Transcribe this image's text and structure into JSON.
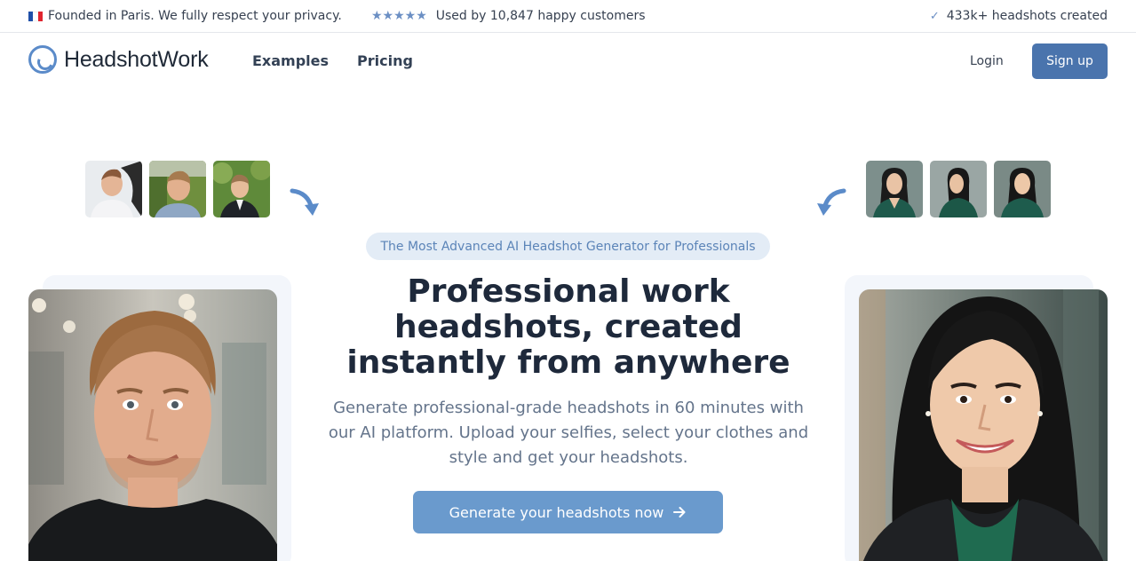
{
  "topbar": {
    "left_text": "Founded in Paris. We fully respect your privacy.",
    "rating_text": "Used by 10,847 happy customers",
    "stars": "★★★★★",
    "right_text": "433k+ headshots created",
    "flag_colors": [
      "#1f4fa8",
      "#ffffff",
      "#e0252f"
    ]
  },
  "header": {
    "logo_text": "HeadshotWork",
    "nav": [
      "Examples",
      "Pricing"
    ],
    "login_label": "Login",
    "signup_label": "Sign up"
  },
  "hero": {
    "tagline": "The Most Advanced AI Headshot Generator for Professionals",
    "headline": "Professional work headshots, created instantly from anywhere",
    "subheadline": "Generate professional-grade headshots in 60 minutes with our AI platform. Upload your selfies, select your clothes and style and get your headshots.",
    "cta_label": "Generate your headshots now",
    "cta_icon": "arrow-right-icon"
  },
  "colors": {
    "primary": "#4a74ad",
    "cta": "#6a9acd",
    "accent": "#6b8fc4",
    "heading": "#1e293b"
  }
}
